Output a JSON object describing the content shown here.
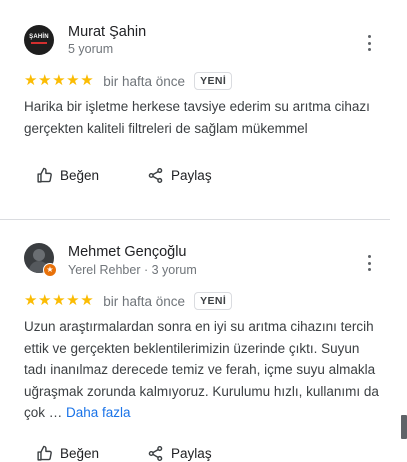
{
  "reviews": [
    {
      "name": "Murat Şahin",
      "meta": "5 yorum",
      "avatar_text": "ŞAHİN",
      "stars": "★★★★★",
      "when": "bir hafta önce",
      "badge": "YENİ",
      "text": "Harika bir işletme herkese tavsiye ederim su arıtma cihazı gerçekten kaliteli filtreleri de sağlam mükemmel",
      "like_label": "Beğen",
      "share_label": "Paylaş"
    },
    {
      "name": "Mehmet Gençoğlu",
      "meta": "Yerel Rehber · 3 yorum",
      "stars": "★★★★★",
      "when": "bir hafta önce",
      "badge": "YENİ",
      "text": "Uzun araştırmalardan sonra en iyi su arıtma cihazını tercih ettik ve gerçekten beklentilerimizin üzerinde çıktı. Suyun tadı inanılmaz derecede temiz ve ferah, içme suyu almakla uğraşmak zorunda kalmıyoruz. Kurulumu hızlı, kullanımı da çok … ",
      "more_label": "Daha fazla",
      "like_label": "Beğen",
      "share_label": "Paylaş"
    }
  ],
  "colors": {
    "star": "#fbbc04",
    "link": "#1a73e8",
    "guide_badge": "#e8710a",
    "meta_text": "#70757a"
  },
  "icons": {
    "more": "more-vert-icon",
    "like": "thumb-up-icon",
    "share": "share-icon",
    "local_guide": "local-guide-star-icon"
  }
}
